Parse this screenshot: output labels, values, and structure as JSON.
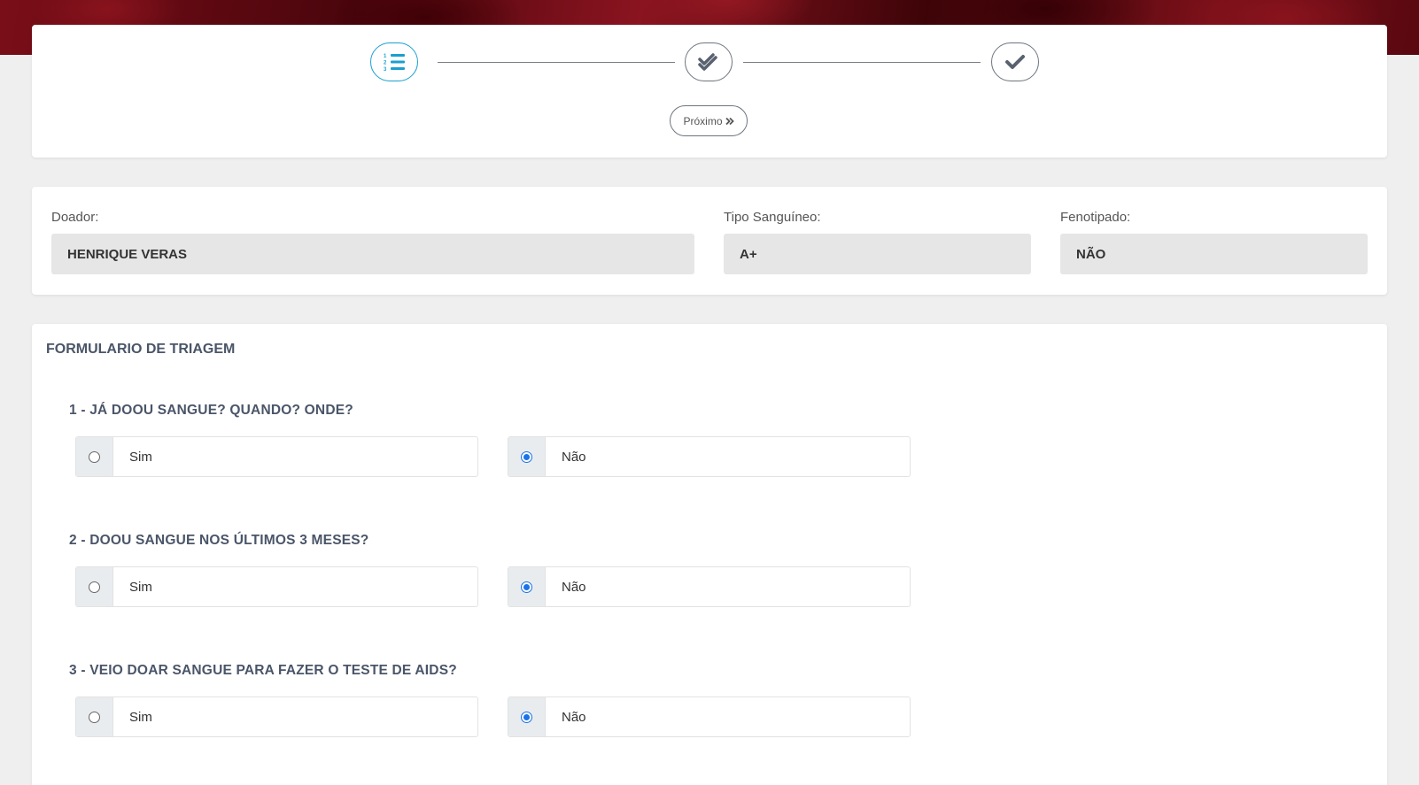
{
  "stepper": {
    "steps": [
      {
        "icon": "list-ordered-icon",
        "active": true
      },
      {
        "icon": "double-check-icon",
        "active": false
      },
      {
        "icon": "check-icon",
        "active": false
      }
    ],
    "next_label": "Próximo",
    "next_icon": "double-chevron-right-icon"
  },
  "donor": {
    "donor_label": "Doador:",
    "donor_value": "HENRIQUE VERAS",
    "blood_type_label": "Tipo Sanguíneo:",
    "blood_type_value": "A+",
    "phenotyped_label": "Fenotipado:",
    "phenotyped_value": "NÃO"
  },
  "form": {
    "title": "FORMULARIO DE TRIAGEM",
    "questions": [
      {
        "text": "1 - JÁ DOOU SANGUE? QUANDO? ONDE?",
        "options": [
          {
            "label": "Sim",
            "checked": false
          },
          {
            "label": "Não",
            "checked": true
          }
        ]
      },
      {
        "text": "2 - DOOU SANGUE NOS ÚLTIMOS 3 MESES?",
        "options": [
          {
            "label": "Sim",
            "checked": false
          },
          {
            "label": "Não",
            "checked": true
          }
        ]
      },
      {
        "text": "3 - VEIO DOAR SANGUE PARA FAZER O TESTE DE AIDS?",
        "options": [
          {
            "label": "Sim",
            "checked": false
          },
          {
            "label": "Não",
            "checked": true
          }
        ]
      }
    ]
  },
  "colors": {
    "accent": "#1a9fd0",
    "radio_checked": "#1a73e8",
    "banner": "#7a0e18"
  }
}
